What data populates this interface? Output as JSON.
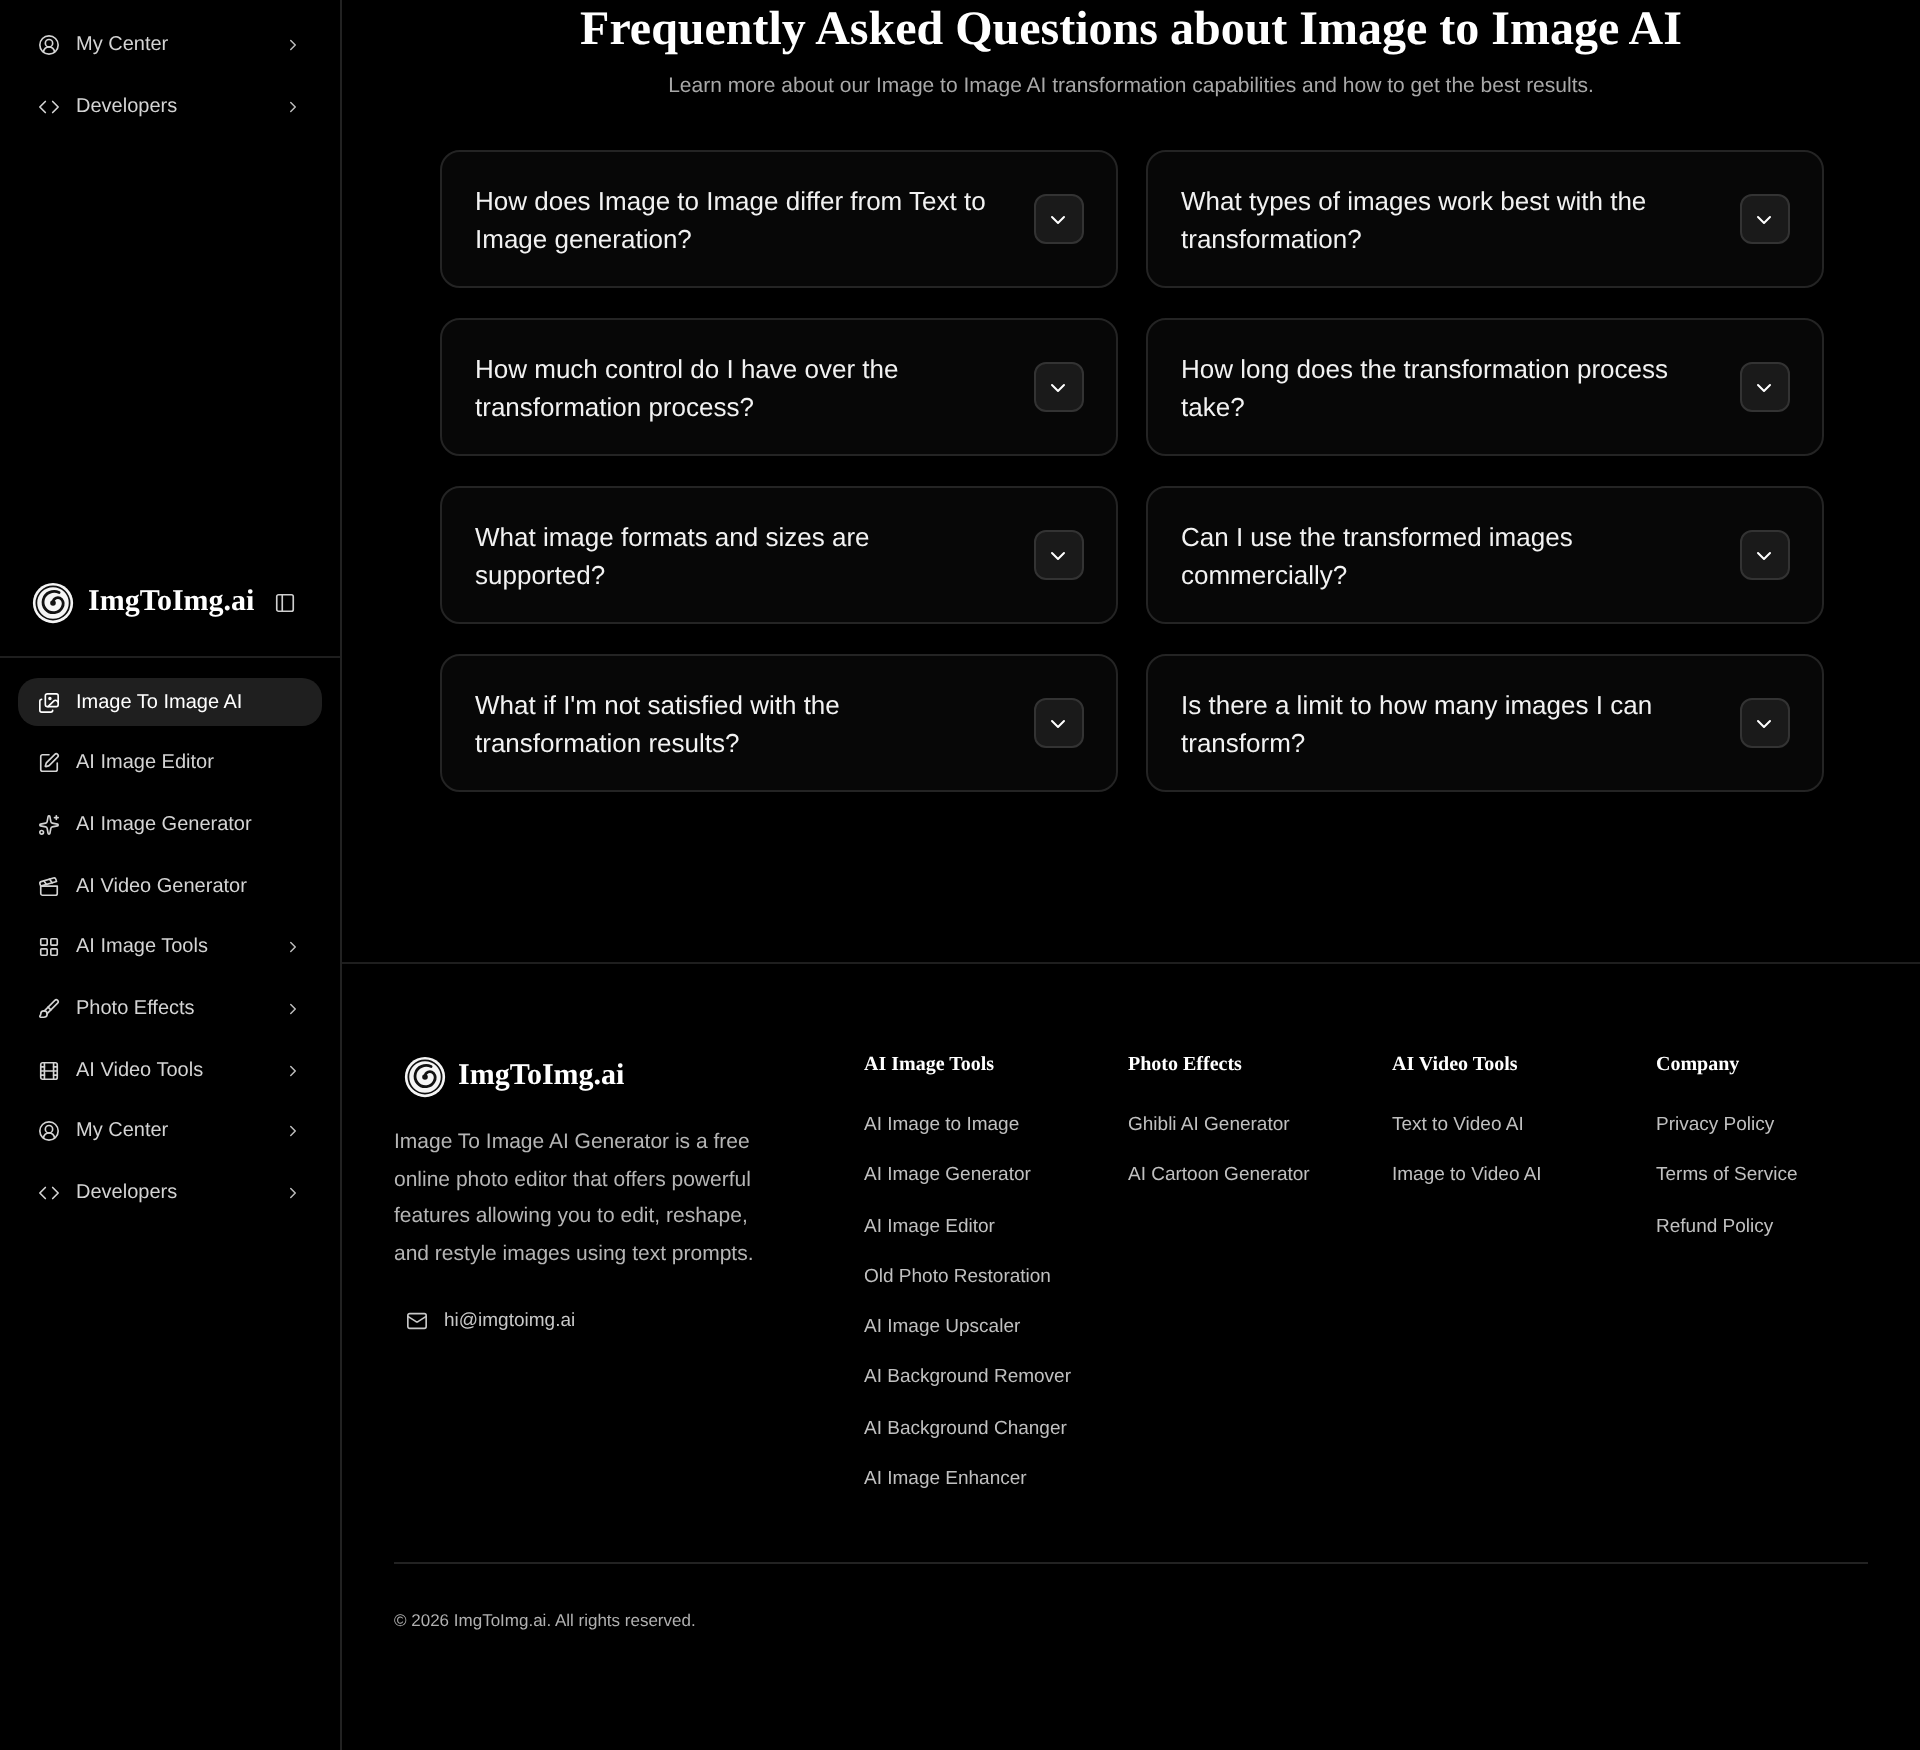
{
  "sidebar": {
    "top_items": [
      {
        "label": "My Center",
        "selected": false,
        "has_submenu": true
      },
      {
        "label": "Developers",
        "selected": false,
        "has_submenu": true
      }
    ],
    "brand": "ImgToImg.ai",
    "items": [
      {
        "label": "Image To Image AI",
        "selected": true,
        "has_submenu": false
      },
      {
        "label": "AI Image Editor",
        "selected": false,
        "has_submenu": false
      },
      {
        "label": "AI Image Generator",
        "selected": false,
        "has_submenu": false
      },
      {
        "label": "AI Video Generator",
        "selected": false,
        "has_submenu": false
      },
      {
        "label": "AI Image Tools",
        "selected": false,
        "has_submenu": true
      },
      {
        "label": "Photo Effects",
        "selected": false,
        "has_submenu": true
      },
      {
        "label": "AI Video Tools",
        "selected": false,
        "has_submenu": true
      },
      {
        "label": "My Center",
        "selected": false,
        "has_submenu": true
      },
      {
        "label": "Developers",
        "selected": false,
        "has_submenu": true
      }
    ]
  },
  "faq": {
    "title": "Frequently Asked Questions about Image to Image AI",
    "subtitle": "Learn more about our Image to Image AI transformation capabilities and how to get the best results.",
    "items": [
      {
        "question": "How does Image to Image differ from Text to Image generation?",
        "expanded": false
      },
      {
        "question": "What types of images work best with the transformation?",
        "expanded": false
      },
      {
        "question": "How much control do I have over the transformation process?",
        "expanded": false
      },
      {
        "question": "How long does the transformation process take?",
        "expanded": false
      },
      {
        "question": "What image formats and sizes are supported?",
        "expanded": false
      },
      {
        "question": "Can I use the transformed images commercially?",
        "expanded": false
      },
      {
        "question": "What if I'm not satisfied with the transformation results?",
        "expanded": false
      },
      {
        "question": "Is there a limit to how many images I can transform?",
        "expanded": false
      }
    ]
  },
  "footer": {
    "brand": "ImgToImg.ai",
    "description": "Image To Image AI Generator is a free online photo editor that offers powerful features allowing you to edit, reshape, and restyle images using text prompts.",
    "email": "hi@imgtoimg.ai",
    "columns": [
      {
        "title": "AI Image Tools",
        "links": [
          "AI Image to Image",
          "AI Image Generator",
          "AI Image Editor",
          "Old Photo Restoration",
          "AI Image Upscaler",
          "AI Background Remover",
          "AI Background Changer",
          "AI Image Enhancer"
        ]
      },
      {
        "title": "Photo Effects",
        "links": [
          "Ghibli AI Generator",
          "AI Cartoon Generator"
        ]
      },
      {
        "title": "AI Video Tools",
        "links": [
          "Text to Video AI",
          "Image to Video AI"
        ]
      },
      {
        "title": "Company",
        "links": [
          "Privacy Policy",
          "Terms of Service",
          "Refund Policy"
        ]
      }
    ],
    "copyright": "© 2026 ImgToImg.ai. All rights reserved."
  }
}
